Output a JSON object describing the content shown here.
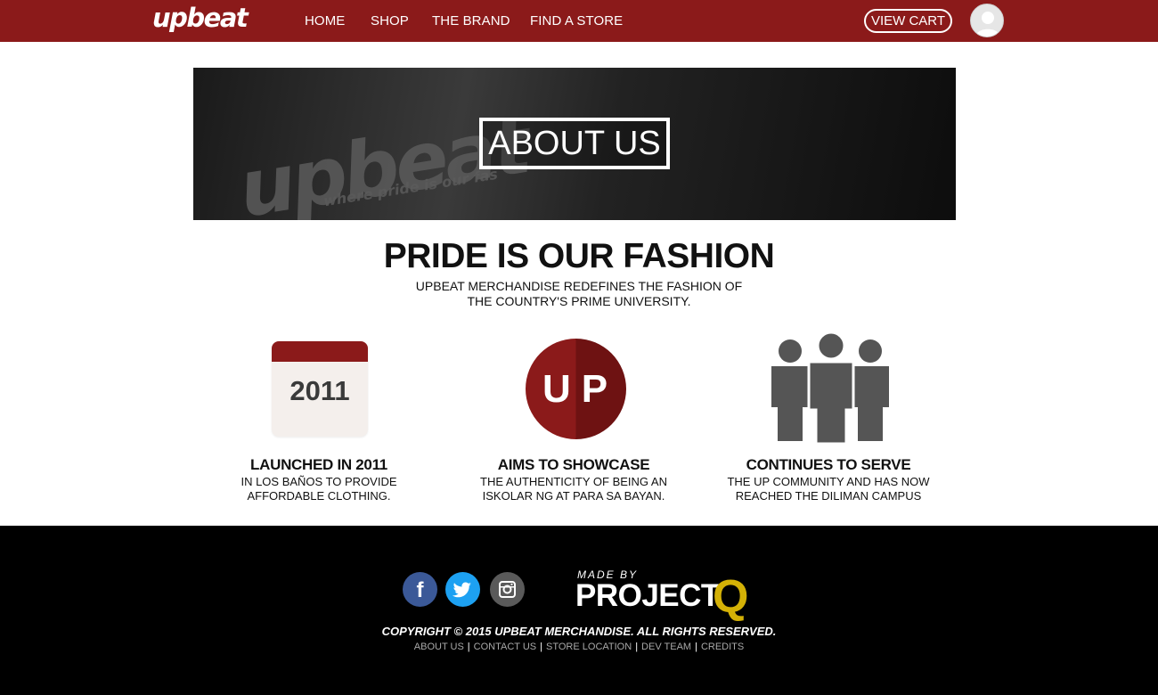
{
  "header": {
    "logo": "upbeat",
    "nav": [
      "HOME",
      "SHOP",
      "THE BRAND",
      "FIND A STORE"
    ],
    "cart_label": "VIEW CART",
    "accent_color": "#8b1a1a"
  },
  "banner": {
    "title": "ABOUT US",
    "bg_logo_text": "upbeat",
    "bg_tagline": "where pride is our fas"
  },
  "main": {
    "headline": "PRIDE IS OUR FASHION",
    "sub_line1": "UPBEAT MERCHANDISE REDEFINES THE FASHION OF",
    "sub_line2": "THE COUNTRY'S PRIME UNIVERSITY."
  },
  "features": [
    {
      "icon": "calendar-icon",
      "icon_text": "2011",
      "title": "LAUNCHED IN 2011",
      "line1": "IN LOS BAÑOS TO PROVIDE",
      "line2": "AFFORDABLE CLOTHING."
    },
    {
      "icon": "up-logo-icon",
      "icon_text": "UP",
      "title": "AIMS TO SHOWCASE",
      "line1": "THE AUTHENTICITY OF BEING AN",
      "line2": "ISKOLAR NG AT PARA SA BAYAN."
    },
    {
      "icon": "people-icon",
      "icon_text": "",
      "title": "CONTINUES TO SERVE",
      "line1": "THE UP COMMUNITY AND HAS NOW",
      "line2": "REACHED THE DILIMAN CAMPUS"
    }
  ],
  "footer": {
    "social": [
      "facebook-icon",
      "twitter-icon",
      "instagram-icon"
    ],
    "made_by": "MADE BY",
    "project": "PROJECT",
    "project_q": "Q",
    "copyright": "COPYRIGHT © 2015 UPBEAT MERCHANDISE.   ALL RIGHTS RESERVED.",
    "links": [
      "ABOUT US",
      "CONTACT US",
      "STORE LOCATION",
      "DEV TEAM",
      "CREDITS"
    ]
  }
}
